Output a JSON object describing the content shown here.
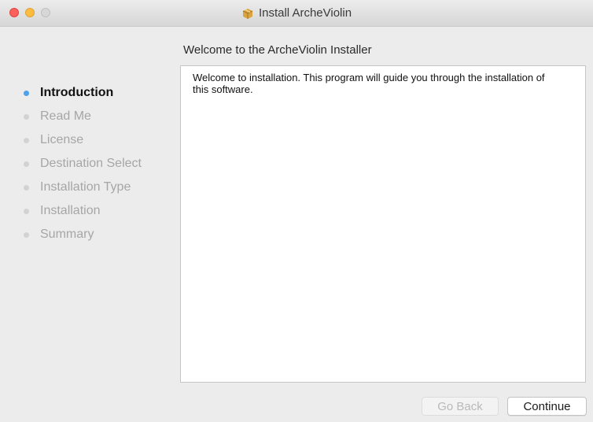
{
  "window": {
    "title": "Install ArcheViolin",
    "icon": "package-icon"
  },
  "sidebar": {
    "steps": [
      {
        "label": "Introduction",
        "active": true
      },
      {
        "label": "Read Me",
        "active": false
      },
      {
        "label": "License",
        "active": false
      },
      {
        "label": "Destination Select",
        "active": false
      },
      {
        "label": "Installation Type",
        "active": false
      },
      {
        "label": "Installation",
        "active": false
      },
      {
        "label": "Summary",
        "active": false
      }
    ]
  },
  "main": {
    "heading": "Welcome to the ArcheViolin Installer",
    "body": "Welcome to installation. This program will guide you through the installation of this software."
  },
  "buttons": {
    "back_label": "Go Back",
    "continue_label": "Continue"
  },
  "colors": {
    "active_dot": "#4ea1e8",
    "close": "#fc605c",
    "minimize": "#fdbc40"
  }
}
